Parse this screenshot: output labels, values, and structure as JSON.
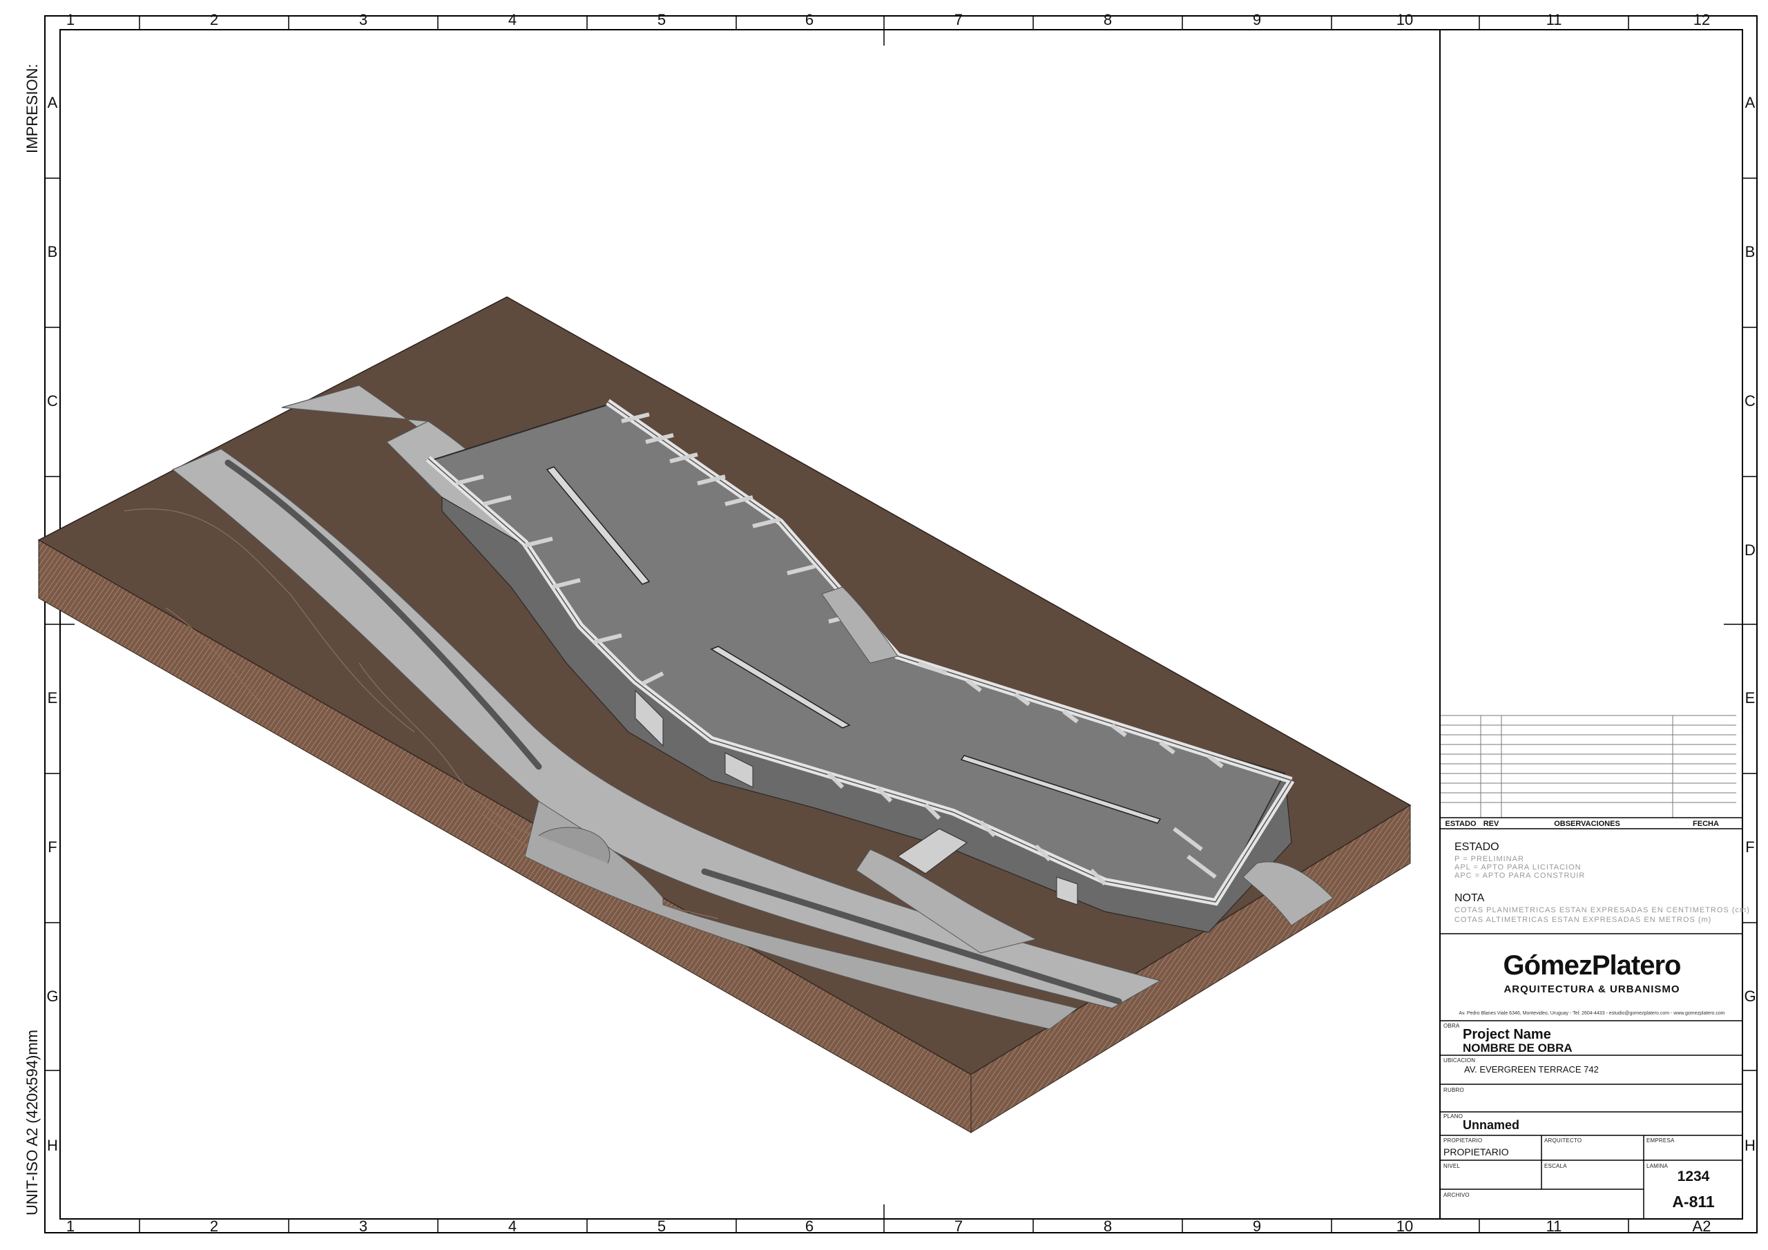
{
  "sheet": {
    "column_numbers_top": [
      "1",
      "2",
      "3",
      "4",
      "5",
      "6",
      "7",
      "8",
      "9",
      "10",
      "11",
      "12"
    ],
    "column_numbers_bottom": [
      "1",
      "2",
      "3",
      "4",
      "5",
      "6",
      "7",
      "8",
      "9",
      "10",
      "11",
      "A2"
    ],
    "row_letters": [
      "A",
      "B",
      "C",
      "D",
      "E",
      "F",
      "G",
      "H"
    ],
    "left_margin_top_text": "IMPRESION:",
    "left_margin_bottom_text": "UNIT-ISO A2  (420x594)mm"
  },
  "revision_table": {
    "headers": [
      "ESTADO",
      "REV",
      "OBSERVACIONES",
      "FECHA"
    ]
  },
  "estado": {
    "title": "ESTADO",
    "lines": [
      "P  =  PRELIMINAR",
      "APL  =  APTO PARA LICITACION",
      "APC  =  APTO PARA CONSTRUIR"
    ]
  },
  "nota": {
    "title": "NOTA",
    "lines": [
      "COTAS PLANIMETRICAS ESTAN EXPRESADAS EN CENTIMETROS (cm)",
      "COTAS ALTIMETRICAS ESTAN EXPRESADAS EN METROS (m)"
    ]
  },
  "company": {
    "name": "GómezPlatero",
    "tagline": "ARQUITECTURA & URBANISMO",
    "address": "Av. Pedro Blanes Viale 6346, Montevideo, Uruguay  -  Tel: 2604-4433  -  estudio@gomezplatero.com  -  www.gomezplatero.com"
  },
  "title_block": {
    "obra_label": "OBRA",
    "project_name": "Project Name",
    "obra_name": "NOMBRE DE OBRA",
    "ubicacion_label": "UBICACION",
    "ubicacion": "AV.  EVERGREEN TERRACE 742",
    "rubro_label": "RUBRO",
    "plano_label": "PLANO",
    "plano": "Unnamed",
    "propietario_label": "PROPIETARIO",
    "propietario": "PROPIETARIO",
    "arquitecto_label": "ARQUITECTO",
    "empresa_label": "EMPRESA",
    "nivel_label": "NIVEL",
    "escala_label": "ESCALA",
    "lamina_label": "LAMINA",
    "lamina_number": "1234",
    "sheet_code": "A-811",
    "archivo_label": "ARCHIVO"
  },
  "colors": {
    "terrain": "#5f4a3e",
    "terrain_side": "#7a5a48",
    "road": "#b4b4b4",
    "roof": "#7a7a7a",
    "structure": "#c9c9c9"
  }
}
